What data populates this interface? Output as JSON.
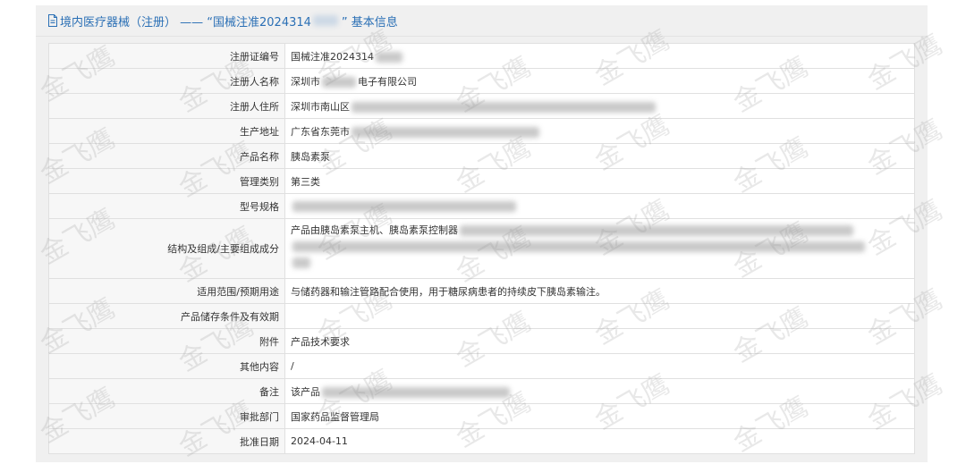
{
  "header": {
    "title_prefix": "境内医疗器械（注册） —— “国械注准2024314",
    "title_suffix": "” 基本信息"
  },
  "rows": [
    {
      "label": "注册证编号",
      "value": "国械注准2024314"
    },
    {
      "label": "注册人名称",
      "value_prefix": "深圳市",
      "value_suffix": "电子有限公司"
    },
    {
      "label": "注册人住所",
      "value": "深圳市南山区"
    },
    {
      "label": "生产地址",
      "value": "广东省东莞市"
    },
    {
      "label": "产品名称",
      "value": "胰岛素泵"
    },
    {
      "label": "管理类别",
      "value": "第三类"
    },
    {
      "label": "型号规格",
      "value": ""
    },
    {
      "label": "结构及组成/主要组成成分",
      "value": "产品由胰岛素泵主机、胰岛素泵控制器"
    },
    {
      "label": "适用范围/预期用途",
      "value": "与储药器和输注管路配合使用，用于糖尿病患者的持续皮下胰岛素输注。"
    },
    {
      "label": "产品储存条件及有效期",
      "value": ""
    },
    {
      "label": "附件",
      "value": "产品技术要求"
    },
    {
      "label": "其他内容",
      "value": "/"
    },
    {
      "label": "备注",
      "value": "该产品"
    },
    {
      "label": "审批部门",
      "value": "国家药品监督管理局"
    },
    {
      "label": "批准日期",
      "value": "2024-04-11"
    }
  ],
  "watermark": "金飞鹰",
  "colors": {
    "header_text": "#2a6fb5",
    "panel_bg": "#f0f0f0"
  }
}
